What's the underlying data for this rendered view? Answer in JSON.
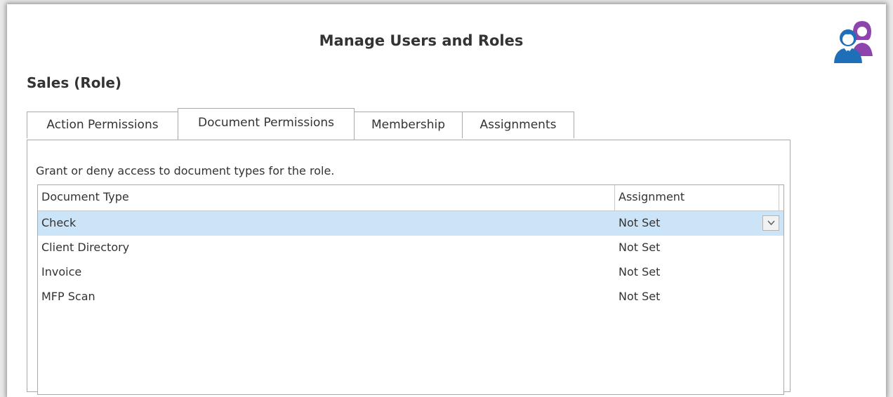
{
  "page": {
    "title": "Manage Users and Roles",
    "role_heading": "Sales (Role)"
  },
  "tabs": [
    {
      "label": "Action Permissions",
      "active": false
    },
    {
      "label": "Document Permissions",
      "active": true
    },
    {
      "label": "Membership",
      "active": false
    },
    {
      "label": "Assignments",
      "active": false
    }
  ],
  "panel": {
    "instruction": "Grant or deny access to document types for the role."
  },
  "grid": {
    "columns": [
      "Document Type",
      "Assignment"
    ],
    "rows": [
      {
        "document_type": "Check",
        "assignment": "Not Set",
        "selected": true
      },
      {
        "document_type": "Client Directory",
        "assignment": "Not Set",
        "selected": false
      },
      {
        "document_type": "Invoice",
        "assignment": "Not Set",
        "selected": false
      },
      {
        "document_type": "MFP Scan",
        "assignment": "Not Set",
        "selected": false
      }
    ]
  },
  "icons": {
    "header": "users-roles-icon",
    "dropdown": "chevron-down-icon"
  },
  "colors": {
    "selection": "#cce4f7",
    "icon_blue": "#1f6fb8",
    "icon_purple": "#8e44ad",
    "border": "#a9a9a9"
  }
}
